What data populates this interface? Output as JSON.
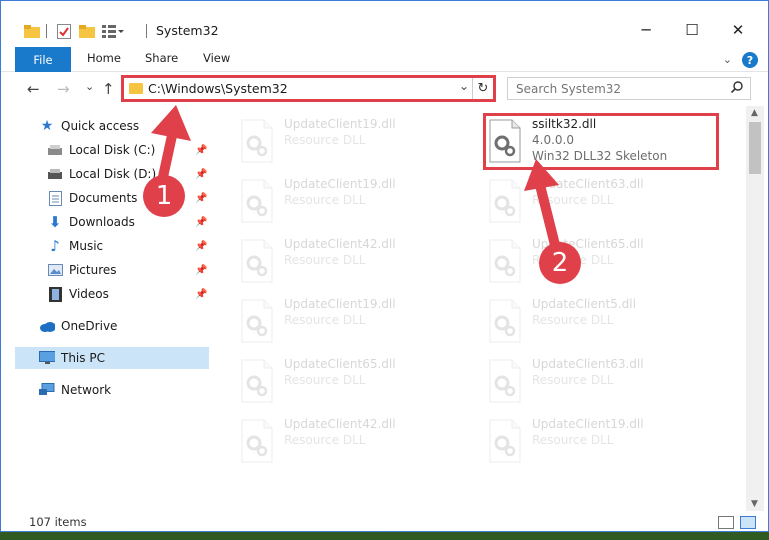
{
  "window": {
    "title": "System32",
    "controls": {
      "minimize": "─",
      "maximize": "☐",
      "close": "✕"
    }
  },
  "ribbon": {
    "file": "File",
    "tabs": [
      "Home",
      "Share",
      "View"
    ],
    "help": "?"
  },
  "nav": {
    "back": "←",
    "forward": "→",
    "recent": "⌄",
    "up": "↑",
    "address": "C:\\Windows\\System32",
    "address_dropdown": "⌄",
    "refresh": "↻",
    "search_placeholder": "Search System32",
    "search_icon": "⚲"
  },
  "sidebar": {
    "items": [
      {
        "label": "Quick access",
        "icon": "star-icon"
      },
      {
        "label": "Local Disk (C:)",
        "icon": "drive-icon",
        "pinned": true
      },
      {
        "label": "Local Disk (D:)",
        "icon": "drive-icon",
        "pinned": true
      },
      {
        "label": "Documents",
        "icon": "documents-icon",
        "pinned": true
      },
      {
        "label": "Downloads",
        "icon": "download-icon",
        "pinned": true
      },
      {
        "label": "Music",
        "icon": "music-icon",
        "pinned": true
      },
      {
        "label": "Pictures",
        "icon": "pictures-icon",
        "pinned": true
      },
      {
        "label": "Videos",
        "icon": "videos-icon",
        "pinned": true
      },
      {
        "label": "OneDrive",
        "icon": "cloud-icon"
      },
      {
        "label": "This PC",
        "icon": "computer-icon",
        "selected": true
      },
      {
        "label": "Network",
        "icon": "network-icon"
      }
    ],
    "pin_glyph": "📌"
  },
  "files": [
    {
      "name": "UpdateClient19.dll",
      "line1": "Resource DLL",
      "line2": "",
      "dim": true
    },
    {
      "name": "ssiltk32.dll",
      "line1": "4.0.0.0",
      "line2": "Win32 DLL32 Skeleton",
      "dim": false
    },
    {
      "name": "UpdateClient19.dll",
      "line1": "Resource DLL",
      "line2": "",
      "dim": true
    },
    {
      "name": "UpdateClient63.dll",
      "line1": "Resource DLL",
      "line2": "",
      "dim": true
    },
    {
      "name": "UpdateClient42.dll",
      "line1": "Resource DLL",
      "line2": "",
      "dim": true
    },
    {
      "name": "UpdateClient65.dll",
      "line1": "Resource DLL",
      "line2": "",
      "dim": true
    },
    {
      "name": "UpdateClient19.dll",
      "line1": "Resource DLL",
      "line2": "",
      "dim": true
    },
    {
      "name": "UpdateClient5.dll",
      "line1": "Resource DLL",
      "line2": "",
      "dim": true
    },
    {
      "name": "UpdateClient65.dll",
      "line1": "Resource DLL",
      "line2": "",
      "dim": true
    },
    {
      "name": "UpdateClient63.dll",
      "line1": "Resource DLL",
      "line2": "",
      "dim": true
    },
    {
      "name": "UpdateClient42.dll",
      "line1": "Resource DLL",
      "line2": "",
      "dim": true
    },
    {
      "name": "UpdateClient19.dll",
      "line1": "Resource DLL",
      "line2": "",
      "dim": true
    }
  ],
  "status": {
    "item_count": "107 items"
  },
  "annotations": {
    "step1": "1",
    "step2": "2",
    "color": "#e0404a"
  }
}
